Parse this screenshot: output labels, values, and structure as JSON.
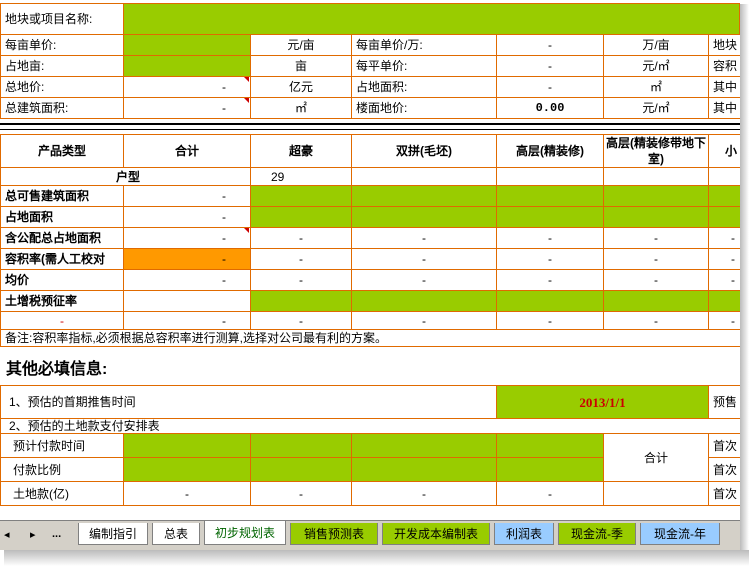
{
  "top": {
    "project_label": "地块或项目名称:",
    "rows": [
      {
        "l1": "每亩单价:",
        "v1": "",
        "u1": "元/亩",
        "l2": "每亩单价/万:",
        "v2": "-",
        "u2": "万/亩",
        "l3": "地块"
      },
      {
        "l1": "占地亩:",
        "v1": "",
        "u1": "亩",
        "l2": "每平单价:",
        "v2": "-",
        "u2": "元/㎡",
        "l3": "容积"
      },
      {
        "l1": "总地价:",
        "v1": "-",
        "u1": "亿元",
        "l2": "占地面积:",
        "v2": "-",
        "u2": "㎡",
        "l3": "其中"
      },
      {
        "l1": "总建筑面积:",
        "v1": "-",
        "u1": "㎡",
        "l2": "楼面地价:",
        "v2": "0.00",
        "u2": "元/㎡",
        "l3": "其中"
      }
    ]
  },
  "product": {
    "headers": [
      "产品类型",
      "合计",
      "超豪",
      "双拼(毛坯)",
      "高层(精装修)",
      "高层(精装修带地下室)",
      "小"
    ],
    "unit_row": {
      "label": "户型",
      "value": "29"
    },
    "rows": [
      {
        "label": "总可售建筑面积",
        "total": "-",
        "cells": [
          "",
          "",
          "",
          "",
          ""
        ]
      },
      {
        "label": "占地面积",
        "total": "-",
        "cells": [
          "",
          "",
          "",
          "",
          ""
        ]
      },
      {
        "label": "含公配总占地面积",
        "total": "-",
        "cells": [
          "-",
          "-",
          "-",
          "-",
          "-"
        ]
      },
      {
        "label": "容积率(需人工校对",
        "total": "-",
        "cells": [
          "-",
          "-",
          "-",
          "-",
          "-"
        ]
      },
      {
        "label": "均价",
        "total": "-",
        "cells": [
          "-",
          "-",
          "-",
          "-",
          "-"
        ]
      },
      {
        "label": "土增税预征率",
        "total": "",
        "cells": [
          "",
          "",
          "",
          "",
          ""
        ]
      }
    ],
    "dash_row": {
      "label": "-",
      "cells": [
        "-",
        "-",
        "-",
        "-",
        "-",
        "-"
      ]
    },
    "note": "备注:容积率指标,必须根据总容积率进行测算,选择对公司最有利的方案。"
  },
  "other": {
    "title": "其他必填信息:",
    "presale_label": "1、预估的首期推售时间",
    "presale_date": "2013/1/1",
    "presale_right": "预售",
    "payment_title": "2、预估的土地款支付安排表",
    "payment_rows": [
      {
        "label": "预计付款时间",
        "cells": [
          "",
          "",
          "",
          ""
        ],
        "right": "首次"
      },
      {
        "label": "付款比例",
        "cells": [
          "",
          "",
          "",
          ""
        ],
        "right": "首次"
      },
      {
        "label": "土地款(亿)",
        "cells": [
          "-",
          "-",
          "-",
          "-"
        ],
        "right": "首次"
      }
    ],
    "total_label": "合计"
  },
  "tabs": {
    "nav": [
      "◂",
      "▸",
      "..."
    ],
    "items": [
      {
        "label": "编制指引",
        "color": "#ffffff"
      },
      {
        "label": "总表",
        "color": "#ffffff"
      },
      {
        "label": "初步规划表",
        "color": "#ffffff"
      },
      {
        "label": "销售预测表",
        "color": "#99cc00"
      },
      {
        "label": "开发成本编制表",
        "color": "#99cc00"
      },
      {
        "label": "利润表",
        "color": "#99ccff"
      },
      {
        "label": "现金流-季",
        "color": "#99cc00"
      },
      {
        "label": "现金流-年",
        "color": "#99ccff"
      }
    ],
    "active": 2
  },
  "colors": {
    "fill": "#99cc00",
    "warn": "#ff9900",
    "grid": "#e06a00",
    "date": "#cc0000"
  }
}
